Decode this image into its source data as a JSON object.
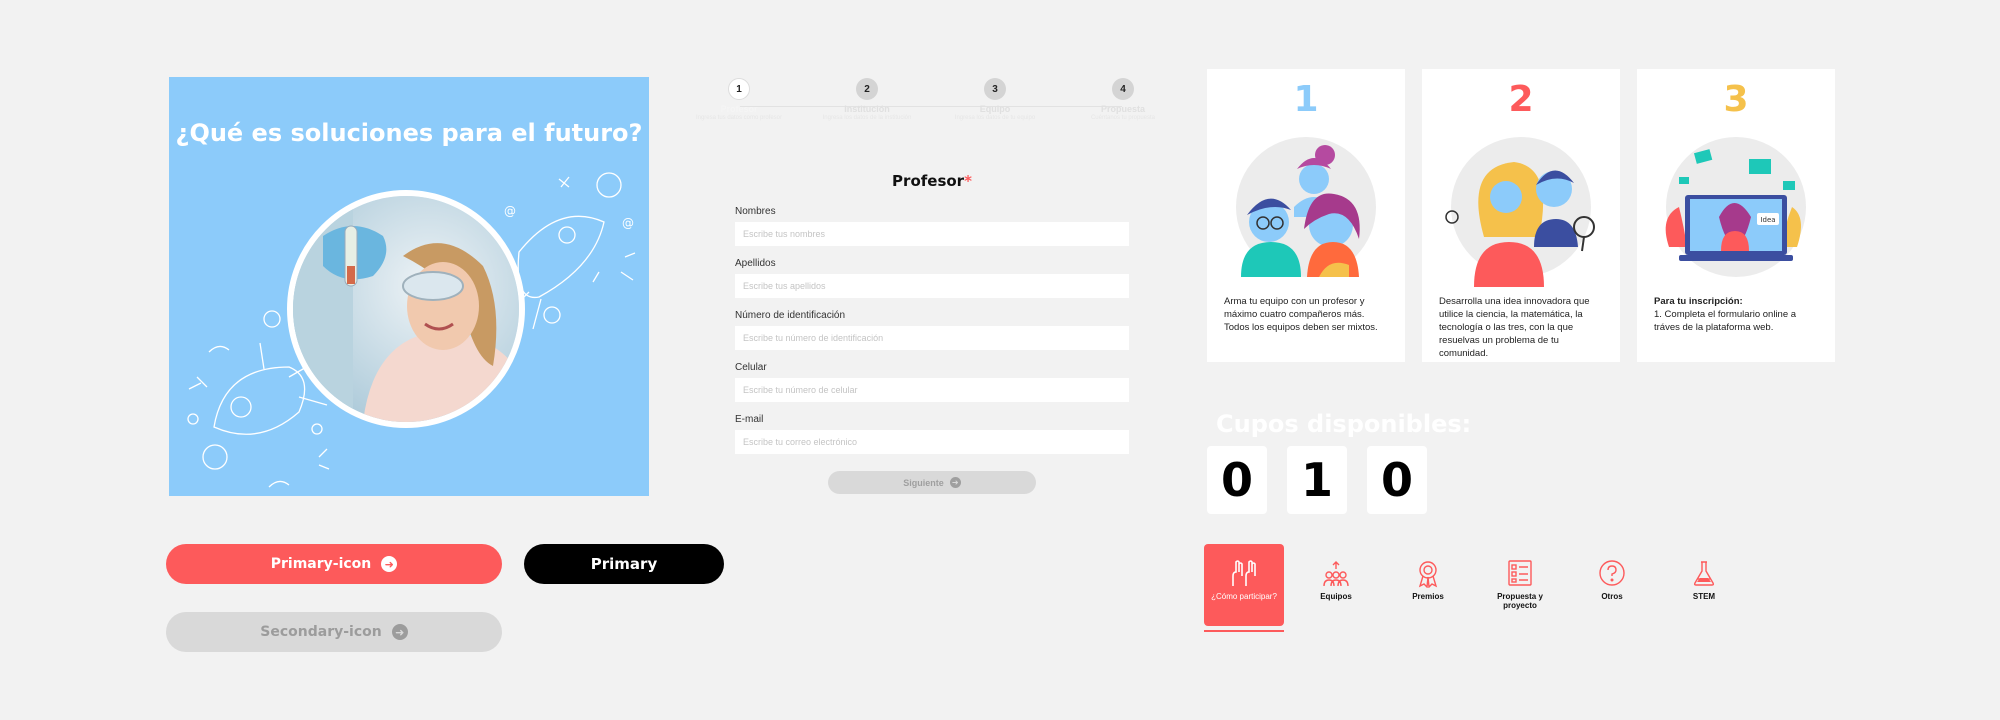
{
  "hero": {
    "title": "¿Qué es soluciones para el futuro?"
  },
  "buttons": {
    "primary_icon": "Primary-icon",
    "primary": "Primary",
    "secondary_icon": "Secondary-icon"
  },
  "stepper": [
    {
      "number": "1",
      "title": "Profesor",
      "subtitle": "Ingresa tus datos como profesor"
    },
    {
      "number": "2",
      "title": "Institución",
      "subtitle": "Ingresa los datos de la institución"
    },
    {
      "number": "3",
      "title": "Equipo",
      "subtitle": "Ingresa los datos de tu equipo"
    },
    {
      "number": "4",
      "title": "Propuesta",
      "subtitle": "Cuéntanos tu propuesta"
    }
  ],
  "form": {
    "title": "Profesor",
    "required_mark": "*",
    "fields": [
      {
        "label": "Nombres",
        "placeholder": "Escribe tus nombres"
      },
      {
        "label": "Apellidos",
        "placeholder": "Escribe tus apellidos"
      },
      {
        "label": "Número de identificación",
        "placeholder": "Escribe tu número de identificación"
      },
      {
        "label": "Celular",
        "placeholder": "Escribe tu número de celular"
      },
      {
        "label": "E-mail",
        "placeholder": "Escribe tu correo electrónico"
      }
    ],
    "next_label": "Siguiente"
  },
  "cards": [
    {
      "number": "1",
      "color": "#8ccbfa",
      "text": "Arma tu equipo con un profesor y máximo cuatro compañeros más. Todos los equipos deben ser mixtos."
    },
    {
      "number": "2",
      "color": "#fd5a5b",
      "text": "Desarrolla una idea innovadora que utilice la ciencia, la matemática, la tecnología o las tres, con la que resuelvas un problema de tu comunidad."
    },
    {
      "number": "3",
      "color": "#f5c14b",
      "heading": "Para tu inscripción:",
      "text": "1. Completa el formulario online a tráves de la plataforma web.",
      "screen_label": "Idea"
    }
  ],
  "counter": {
    "label": "Cupos disponibles:",
    "digits": [
      "0",
      "1",
      "0"
    ]
  },
  "tabs": [
    {
      "label": "¿Cómo participar?",
      "icon": "raised-hands-icon",
      "active": true
    },
    {
      "label": "Equipos",
      "icon": "team-icon",
      "active": false
    },
    {
      "label": "Premios",
      "icon": "award-ribbon-icon",
      "active": false
    },
    {
      "label": "Propuesta y proyecto",
      "icon": "checklist-icon",
      "active": false
    },
    {
      "label": "Otros",
      "icon": "question-icon",
      "active": false
    },
    {
      "label": "STEM",
      "icon": "flask-icon",
      "active": false
    }
  ],
  "colors": {
    "accent": "#fd5a5b",
    "sky": "#8ccbfa",
    "yellow": "#f5c14b",
    "disabled": "#d9d9d9"
  }
}
